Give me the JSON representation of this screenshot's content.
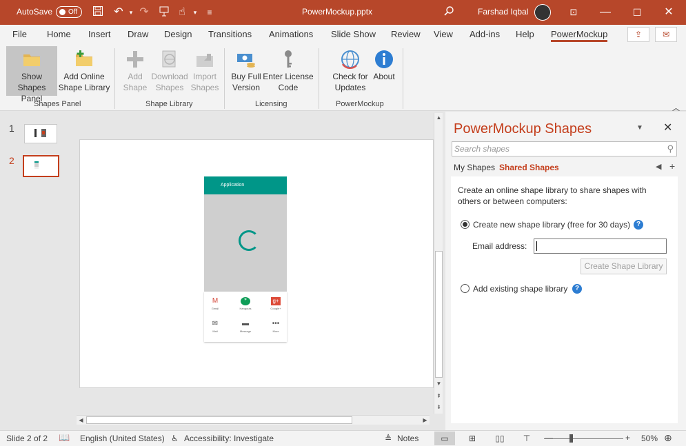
{
  "titlebar": {
    "autosave_label": "AutoSave",
    "autosave_state": "Off",
    "document_title": "PowerMockup.pptx",
    "user_name": "Farshad Iqbal"
  },
  "menu": {
    "tabs": [
      "File",
      "Home",
      "Insert",
      "Draw",
      "Design",
      "Transitions",
      "Animations",
      "Slide Show",
      "Review",
      "View",
      "Add-ins",
      "Help",
      "PowerMockup"
    ],
    "active_tab": "PowerMockup"
  },
  "ribbon": {
    "buttons": {
      "show_shapes_panel": [
        "Show",
        "Shapes Panel"
      ],
      "add_online_shape_library": [
        "Add Online",
        "Shape Library"
      ],
      "add_shape": [
        "Add",
        "Shape"
      ],
      "download_shapes": [
        "Download",
        "Shapes"
      ],
      "import_shapes": [
        "Import",
        "Shapes"
      ],
      "buy_full_version": [
        "Buy Full",
        "Version"
      ],
      "enter_license_code": [
        "Enter License",
        "Code"
      ],
      "check_for_updates": [
        "Check for",
        "Updates"
      ],
      "about": [
        "About",
        ""
      ]
    },
    "groups": {
      "shapes_panel": "Shapes Panel",
      "shape_library": "Shape Library",
      "licensing": "Licensing",
      "powermockup": "PowerMockup"
    }
  },
  "slides": {
    "numbers": [
      "1",
      "2"
    ],
    "active": "2"
  },
  "mockup": {
    "appbar_title": "Application",
    "apps": [
      "Gmail",
      "Hangouts",
      "Google+",
      "Mail",
      "Message",
      "More"
    ]
  },
  "panel": {
    "title": "PowerMockup Shapes",
    "search_placeholder": "Search shapes",
    "tabs": [
      "My Shapes",
      "Shared Shapes"
    ],
    "active_tab": "Shared Shapes",
    "description": "Create an online shape library to share shapes with others or between computers:",
    "option_new": "Create new shape library (free for 30 days)",
    "email_label": "Email address:",
    "email_value": "",
    "create_button": "Create Shape Library",
    "option_existing": "Add existing shape library"
  },
  "statusbar": {
    "slide_info": "Slide 2 of 2",
    "language": "English (United States)",
    "accessibility": "Accessibility: Investigate",
    "notes": "Notes",
    "zoom": "50%"
  },
  "colors": {
    "accent": "#b7472a",
    "panel_title": "#c43e1c",
    "appbar": "#009688",
    "help": "#2d7dd2"
  }
}
